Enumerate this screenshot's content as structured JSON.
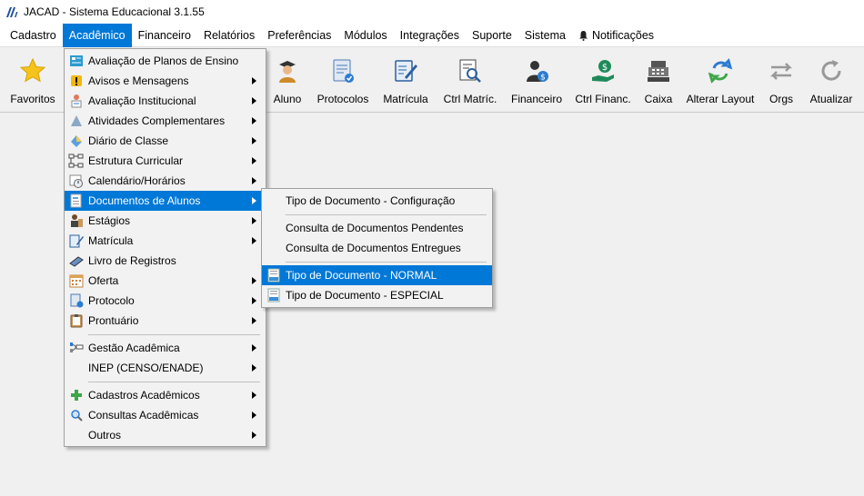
{
  "window": {
    "title": "JACAD - Sistema Educacional 3.1.55"
  },
  "menubar": {
    "items": [
      "Cadastro",
      "Acadêmico",
      "Financeiro",
      "Relatórios",
      "Preferências",
      "Módulos",
      "Integrações",
      "Suporte",
      "Sistema"
    ],
    "active": "Acadêmico",
    "notifications": "Notificações"
  },
  "toolbar": {
    "items": [
      {
        "label": "Favoritos",
        "icon": "star-icon"
      },
      {
        "label": "Aluno",
        "icon": "student-icon"
      },
      {
        "label": "Protocolos",
        "icon": "protocol-icon"
      },
      {
        "label": "Matrícula",
        "icon": "enrollment-icon"
      },
      {
        "label": "Ctrl Matríc.",
        "icon": "search-document-icon"
      },
      {
        "label": "Financeiro",
        "icon": "finance-person-icon"
      },
      {
        "label": "Ctrl Financ.",
        "icon": "money-hand-icon"
      },
      {
        "label": "Caixa",
        "icon": "cash-register-icon"
      },
      {
        "label": "Alterar Layout",
        "icon": "refresh-layout-icon"
      },
      {
        "label": "Orgs",
        "icon": "swap-arrows-icon"
      },
      {
        "label": "Atualizar",
        "icon": "reload-icon"
      }
    ]
  },
  "academic_menu": {
    "items": [
      {
        "label": "Avaliação de Planos de Ensino",
        "icon": "plan-icon",
        "submenu": false
      },
      {
        "label": "Avisos e Mensagens",
        "icon": "warning-icon",
        "submenu": true
      },
      {
        "label": "Avaliação Institucional",
        "icon": "evaluation-icon",
        "submenu": true
      },
      {
        "label": "Atividades Complementares",
        "icon": "activities-icon",
        "submenu": true
      },
      {
        "label": "Diário de Classe",
        "icon": "diary-icon",
        "submenu": true
      },
      {
        "label": "Estrutura Curricular",
        "icon": "structure-icon",
        "submenu": true
      },
      {
        "label": "Calendário/Horários",
        "icon": "calendar-clock-icon",
        "submenu": true
      },
      {
        "label": "Documentos de Alunos",
        "icon": "documents-icon",
        "submenu": true,
        "highlighted": true
      },
      {
        "label": "Estágios",
        "icon": "internship-icon",
        "submenu": true
      },
      {
        "label": "Matrícula",
        "icon": "enrollment-icon",
        "submenu": true
      },
      {
        "label": "Livro de Registros",
        "icon": "book-icon",
        "submenu": false
      },
      {
        "label": "Oferta",
        "icon": "offer-calendar-icon",
        "submenu": true
      },
      {
        "label": "Protocolo",
        "icon": "protocol-icon",
        "submenu": true
      },
      {
        "label": "Prontuário",
        "icon": "clipboard-icon",
        "submenu": true
      },
      {
        "separator": true
      },
      {
        "label": "Gestão Acadêmica",
        "icon": "management-icon",
        "submenu": true
      },
      {
        "label": "INEP (CENSO/ENADE)",
        "icon": "",
        "submenu": true
      },
      {
        "separator": true
      },
      {
        "label": "Cadastros Acadêmicos",
        "icon": "plus-icon",
        "submenu": true
      },
      {
        "label": "Consultas Acadêmicas",
        "icon": "magnifier-icon",
        "submenu": true
      },
      {
        "label": "Outros",
        "icon": "",
        "submenu": true
      }
    ]
  },
  "documents_submenu": {
    "items": [
      {
        "label": "Tipo de Documento - Configuração",
        "icon": ""
      },
      {
        "separator": true
      },
      {
        "label": "Consulta de Documentos Pendentes",
        "icon": ""
      },
      {
        "label": "Consulta de Documentos Entregues",
        "icon": ""
      },
      {
        "separator": true
      },
      {
        "label": "Tipo de Documento - NORMAL",
        "icon": "doc-type-icon",
        "highlighted": true
      },
      {
        "label": "Tipo de Documento - ESPECIAL",
        "icon": "doc-type-icon"
      }
    ]
  },
  "colors": {
    "accent": "#0078d7",
    "menu_bg": "#f2f2f2",
    "window_bg": "#f0f0f0"
  }
}
